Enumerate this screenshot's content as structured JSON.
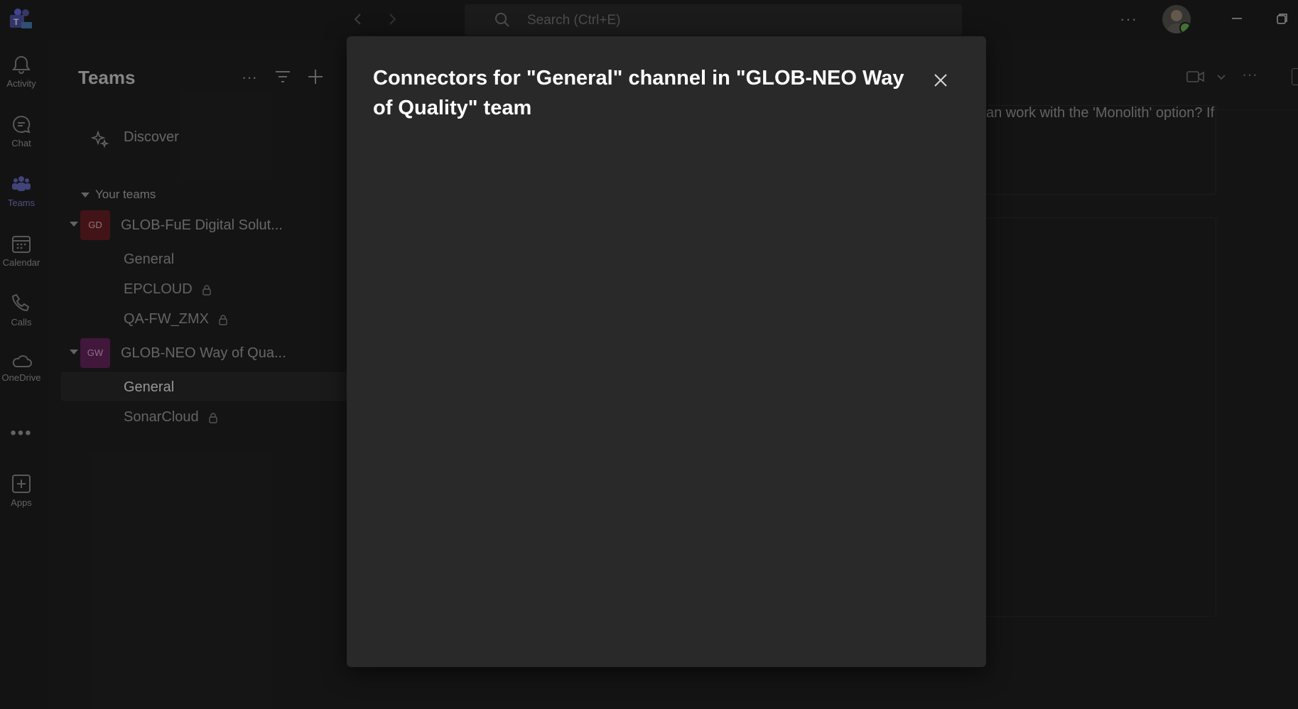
{
  "rail": {
    "items": [
      {
        "label": "Activity",
        "icon": "bell-icon"
      },
      {
        "label": "Chat",
        "icon": "chat-icon"
      },
      {
        "label": "Teams",
        "icon": "teams-icon",
        "active": true
      },
      {
        "label": "Calendar",
        "icon": "calendar-icon"
      },
      {
        "label": "Calls",
        "icon": "phone-icon"
      },
      {
        "label": "OneDrive",
        "icon": "cloud-icon"
      },
      {
        "label": "",
        "icon": "more-icon"
      },
      {
        "label": "Apps",
        "icon": "add-app-icon"
      }
    ],
    "active_color": "#6f6fb8"
  },
  "topbar": {
    "search_placeholder": "Search (Ctrl+E)"
  },
  "panel": {
    "title": "Teams",
    "discover_label": "Discover",
    "section_label": "Your teams",
    "teams": [
      {
        "initials": "GD",
        "name": "GLOB-FuE Digital Solut...",
        "tile_color": "#7a1f22",
        "channels": [
          {
            "name": "General",
            "private": false
          },
          {
            "name": "EPCLOUD",
            "private": true
          },
          {
            "name": "QA-FW_ZMX",
            "private": true
          }
        ]
      },
      {
        "initials": "GW",
        "name": "GLOB-NEO Way of Qua...",
        "tile_color": "#6b2560",
        "channels": [
          {
            "name": "General",
            "private": false,
            "selected": true
          },
          {
            "name": "SonarCloud",
            "private": true
          }
        ]
      }
    ]
  },
  "main": {
    "message_fragment": "an work with the 'Monolith' option? If"
  },
  "dialog": {
    "title": "Connectors for \"General\" channel in \"GLOB-NEO Way of Quality\" team",
    "close_icon": "close-icon"
  }
}
